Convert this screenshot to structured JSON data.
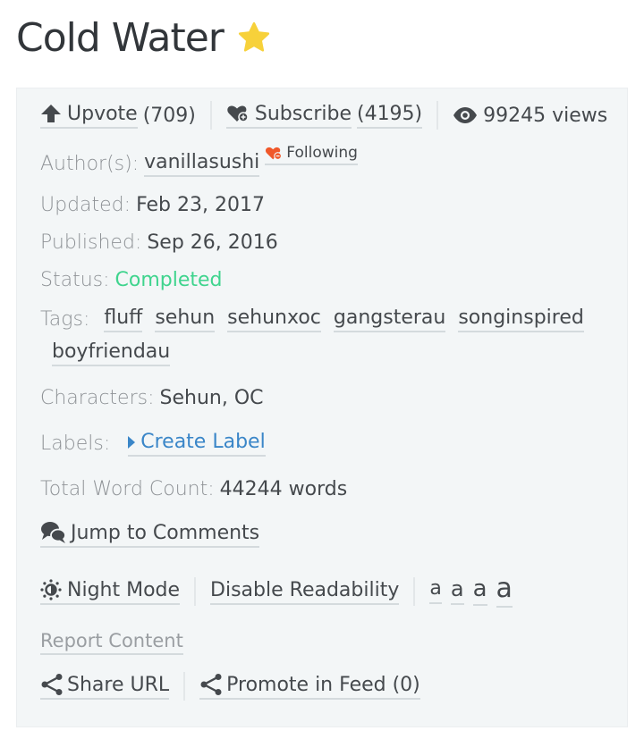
{
  "story": {
    "title": "Cold Water",
    "star_icon": "star-icon",
    "star_color": "#f7d13a"
  },
  "stats": {
    "upvote_label": "Upvote",
    "upvote_count": "(709)",
    "subscribe_label": "Subscribe",
    "subscribe_count": "(4195)",
    "views": "99245 views"
  },
  "meta": {
    "author_label": "Author(s):",
    "author_name": "vanillasushi",
    "following_label": "Following",
    "following_color": "#f0582a",
    "updated_label": "Updated:",
    "updated_value": "Feb 23, 2017",
    "published_label": "Published:",
    "published_value": "Sep 26, 2016",
    "status_label": "Status:",
    "status_value": "Completed",
    "status_color": "#3fd48e",
    "tags_label": "Tags:",
    "tags": [
      "fluff",
      "sehun",
      "sehunxoc",
      "gangsterau",
      "songinspired",
      "boyfriendau"
    ],
    "characters_label": "Characters:",
    "characters_value": "Sehun, OC",
    "labels_label": "Labels:",
    "create_label": "Create Label",
    "word_count_label": "Total Word Count:",
    "word_count_value": "44244 words"
  },
  "actions": {
    "jump_comments": "Jump to Comments",
    "night_mode": "Night Mode",
    "disable_readability": "Disable Readability",
    "font_sizes": [
      "a",
      "a",
      "a",
      "a"
    ],
    "report_content": "Report Content",
    "share_url": "Share URL",
    "promote_feed": "Promote in Feed (0)"
  },
  "colors": {
    "panel_bg": "#f3f6f7",
    "text": "#45494d",
    "label": "#8e9296",
    "link_blue": "#3a86c8"
  }
}
